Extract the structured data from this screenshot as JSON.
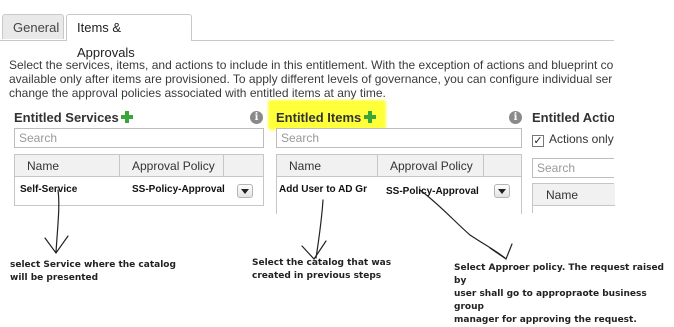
{
  "tabs": [
    {
      "label": "General",
      "active": false
    },
    {
      "label": "Items & Approvals",
      "active": true
    }
  ],
  "description": {
    "line1": "Select the services, items, and actions to include in this entitlement. With the exception of actions and blueprint co",
    "line2": "available only after items are provisioned. To apply different levels of governance, you can configure individual ser",
    "line3": "change the approval policies associated with entitled items at any time."
  },
  "entitled_services": {
    "title": "Entitled Services",
    "search_placeholder": "Search",
    "columns": [
      "Name",
      "Approval Policy"
    ],
    "rows": [
      {
        "name": "Self-Service",
        "policy": "SS-Policy-Approval"
      }
    ]
  },
  "entitled_items": {
    "title": "Entitled Items",
    "search_placeholder": "Search",
    "columns": [
      "Name",
      "Approval Policy"
    ],
    "rows": [
      {
        "name": "Add User to AD Gr",
        "policy": "SS-Policy-Approval"
      }
    ]
  },
  "entitled_actions": {
    "title": "Entitled Action",
    "checkbox_label": "Actions only",
    "checked": true,
    "search_placeholder": "Search",
    "columns": [
      "Name"
    ]
  },
  "annotations": {
    "services_note_l1": "select Service where the catalog",
    "services_note_l2": "will be presented",
    "items_note_l1": "Select the catalog that was",
    "items_note_l2": "created in previous steps",
    "policy_note_l1": "Select Approer policy. The request raised by",
    "policy_note_l2": "user shall go to appropraote business group",
    "policy_note_l3": "manager for approving the request."
  },
  "colors": {
    "highlight": "#ffff3a",
    "plus": "#3aa63a"
  }
}
